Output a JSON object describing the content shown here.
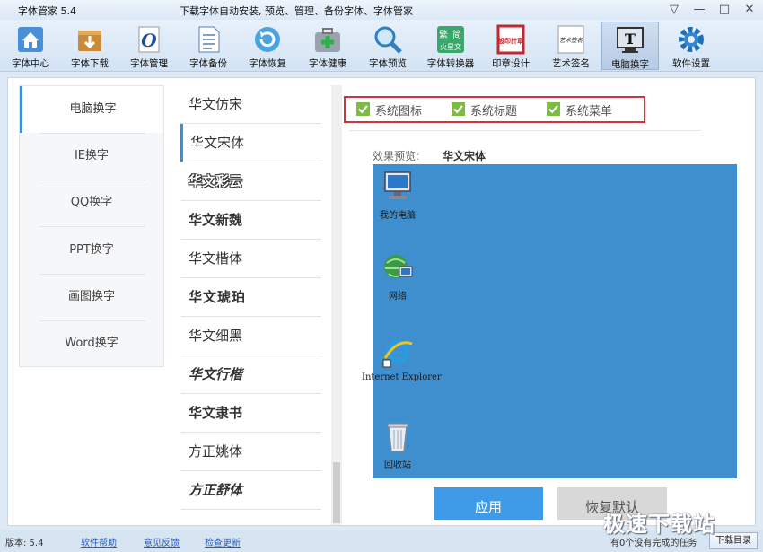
{
  "window": {
    "title": "字体管家 5.4",
    "subtitle": "下载字体自动安装, 预览、管理、备份字体、字体管家",
    "controls": [
      "▽",
      "—",
      "□",
      "✕"
    ]
  },
  "toolbar": {
    "items": [
      {
        "label": "字体中心",
        "icon": "house-icon"
      },
      {
        "label": "字体下载",
        "icon": "download-box-icon"
      },
      {
        "label": "字体管理",
        "icon": "font-manage-icon"
      },
      {
        "label": "字体备份",
        "icon": "document-icon"
      },
      {
        "label": "字体恢复",
        "icon": "restore-icon"
      },
      {
        "label": "字体健康",
        "icon": "medkit-icon"
      },
      {
        "label": "字体预览",
        "icon": "magnifier-icon"
      },
      {
        "label": "字体转换器",
        "icon": "converter-icon"
      },
      {
        "label": "印章设计",
        "icon": "seal-icon"
      },
      {
        "label": "艺术签名",
        "icon": "signature-icon"
      },
      {
        "label": "电脑换字",
        "icon": "font-change-icon"
      },
      {
        "label": "软件设置",
        "icon": "gear-icon"
      }
    ],
    "seal_text": "設印計章",
    "converter_text": [
      "繁",
      "简",
      "火星文"
    ],
    "signature_text": "艺术签名",
    "font_change_glyph": "T"
  },
  "nav": {
    "items": [
      "电脑换字",
      "IE换字",
      "QQ换字",
      "PPT换字",
      "画图换字",
      "Word换字"
    ],
    "active_index": 0
  },
  "fonts": {
    "items": [
      "华文仿宋",
      "华文宋体",
      "华文彩云",
      "华文新魏",
      "华文楷体",
      "华文琥珀",
      "华文细黑",
      "华文行楷",
      "华文隶书",
      "方正姚体",
      "方正舒体"
    ],
    "selected_index": 1
  },
  "options": [
    {
      "label": "系统图标",
      "checked": true
    },
    {
      "label": "系统标题",
      "checked": true
    },
    {
      "label": "系统菜单",
      "checked": true
    }
  ],
  "preview": {
    "label": "效果预览:",
    "font_name": "华文宋体",
    "desktop_icons": [
      {
        "label": "我的电脑",
        "icon": "computer-icon"
      },
      {
        "label": "网络",
        "icon": "network-icon"
      },
      {
        "label": "Internet Explorer",
        "icon": "ie-icon"
      },
      {
        "label": "回收站",
        "icon": "recycle-bin-icon"
      }
    ],
    "background_color": "#3f8fcf"
  },
  "buttons": {
    "apply": "应用",
    "reset": "恢复默认"
  },
  "status": {
    "version": "版本: 5.4",
    "links": [
      "软件帮助",
      "意见反馈",
      "检查更新"
    ],
    "tasks": "有0个没有完成的任务",
    "download_dir": "下载目录"
  },
  "watermark": "极速下载站",
  "colors": {
    "accent": "#3d8ede",
    "highlight_box": "#d3333b",
    "check": "#7cbc42",
    "apply_button": "#3f9ae8"
  }
}
